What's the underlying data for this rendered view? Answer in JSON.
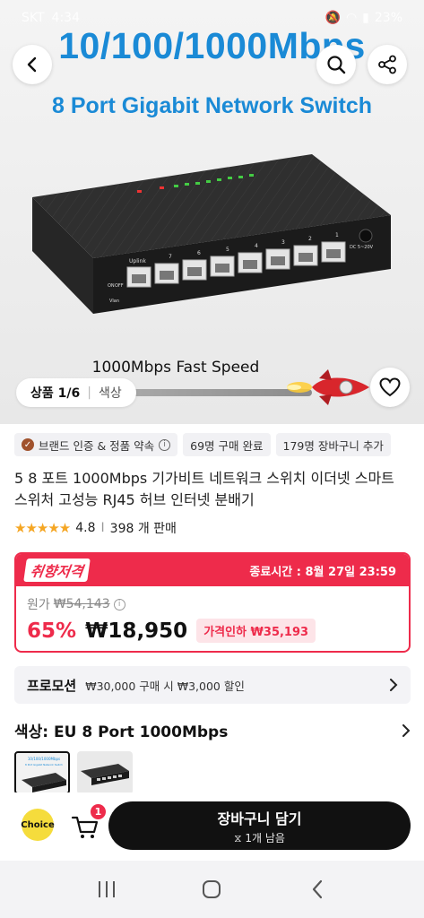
{
  "status_bar": {
    "carrier": "SKT",
    "time": "4:34",
    "battery": "23%"
  },
  "hero": {
    "banner_title": "10/100/1000Mbps",
    "banner_subtitle": "8 Port Gigabit Network Switch",
    "speed_caption": "1000Mbps Fast Speed",
    "switch_labels": {
      "uplink": "Uplink",
      "dc": "DC 5~20V",
      "on": "ON",
      "off": "OFF",
      "vlan": "Vlan",
      "ports": [
        "7",
        "6",
        "5",
        "4",
        "3",
        "2",
        "1"
      ]
    },
    "pager": {
      "label": "상품",
      "current": "1/6",
      "separator": "|",
      "value": "색상"
    }
  },
  "tags": {
    "brand": "브랜드 인증 & 정품 약속",
    "purchased": "69명 구매 완료",
    "in_cart": "179명 장바구니 추가"
  },
  "product": {
    "title": "5 8 포트 1000Mbps 기가비트 네트워크 스위치 이더넷 스마트 스위처 고성능 RJ45 허브 인터넷 분배기",
    "rating": "4.8",
    "rating_value": 4.8,
    "rating_sep": "I",
    "sold": "398 개 판매"
  },
  "deal": {
    "badge": "취향저격",
    "end_time": "종료시간 : 8월 27일 23:59",
    "original_label": "원가",
    "original_price": "₩54,143",
    "discount": "65%",
    "price": "₩18,950",
    "price_drop": "가격인하 ₩35,193"
  },
  "promotion": {
    "label": "프로모션",
    "text": "₩30,000 구매 시 ₩3,000 할인"
  },
  "color": {
    "label": "색상: EU 8 Port 1000Mbps"
  },
  "thumbs": {
    "first_title": "10/100/1000Mbps",
    "first_sub": "8 Port Gigabit Network Switch"
  },
  "action_bar": {
    "choice": "Choice",
    "cart_badge": "1",
    "button_main": "장바구니 담기",
    "button_sub": "1개 남음"
  },
  "colors": {
    "accent": "#ee2b4b",
    "brand_blue": "#1a8ad6",
    "star": "#f5a623",
    "choice": "#f5dc3c"
  }
}
